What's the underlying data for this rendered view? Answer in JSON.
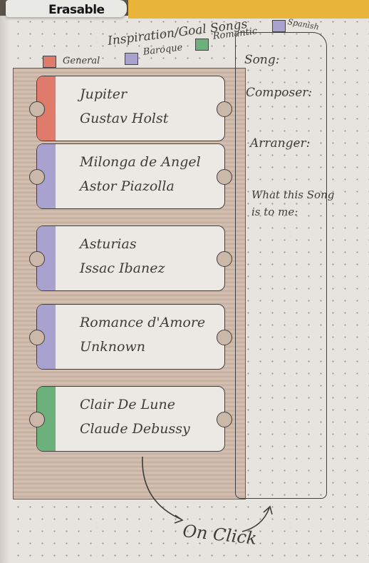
{
  "marker_label": "Erasable",
  "title": "Inspiration/Goal Songs",
  "legend": [
    {
      "label": "General",
      "color": "#e07a6a"
    },
    {
      "label": "Baroque",
      "color": "#a9a2cf"
    },
    {
      "label": "Romantic",
      "color": "#6cb07c"
    },
    {
      "label": "Spanish",
      "color": "#a9a2cf"
    }
  ],
  "songs": [
    {
      "title": "Jupiter",
      "composer": "Gustav Holst",
      "color": "#e07a6a"
    },
    {
      "title": "Milonga de Angel",
      "composer": "Astor Piazolla",
      "color": "#a9a2cf"
    },
    {
      "title": "Asturias",
      "composer": "Issac Ibanez",
      "color": "#a9a2cf"
    },
    {
      "title": "Romance d'Amore",
      "composer": "Unknown",
      "color": "#a9a2cf"
    },
    {
      "title": "Clair De Lune",
      "composer": "Claude Debussy",
      "color": "#6cb07c"
    }
  ],
  "details": {
    "song": "Song:",
    "composer": "Composer:",
    "arranger": "Arranger:",
    "meaning_line1": "What this Song",
    "meaning_line2": "is to me:"
  },
  "annotation": "On Click"
}
